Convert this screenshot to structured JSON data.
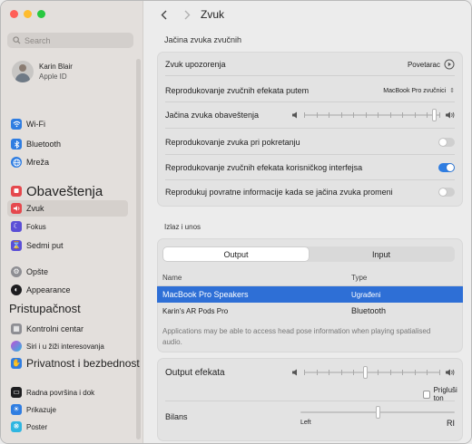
{
  "sidebar": {
    "search_placeholder": "Search",
    "account": {
      "name": "Karin Blair",
      "subtitle": "Apple ID"
    },
    "items": [
      {
        "label": "Wi-Fi",
        "icon": "wifi-icon",
        "color": "#2f7de1"
      },
      {
        "label": "Bluetooth",
        "icon": "bluetooth-icon",
        "color": "#2f7de1"
      },
      {
        "label": "Mreža",
        "icon": "globe-icon",
        "color": "#2f7de1"
      },
      {
        "label": "Obaveštenja",
        "icon": "bell-icon",
        "color": "#e5484d"
      },
      {
        "label": "Zvuk",
        "icon": "speaker-icon",
        "color": "#e5484d"
      },
      {
        "label": "Fokus",
        "icon": "moon-icon",
        "color": "#5b4fd6"
      },
      {
        "label": "Sedmi put",
        "icon": "hourglass-icon",
        "color": "#5b4fd6"
      },
      {
        "label": "Opšte",
        "icon": "gear-icon",
        "color": "#8e8e93"
      },
      {
        "label": "Appearance",
        "icon": "appearance-icon",
        "color": "#1d1d1f"
      },
      {
        "label": "Pristupačnost",
        "icon": "",
        "color": ""
      },
      {
        "label": "Kontrolni centar",
        "icon": "control-center-icon",
        "color": "#8e8e93"
      },
      {
        "label": "Siri i u žiži interesovanja",
        "icon": "siri-icon",
        "color": "#c04fd6"
      },
      {
        "label": "Privatnost i bezbednost",
        "icon": "hand-icon",
        "color": "#2f7de1"
      },
      {
        "label": "Radna površina i dok",
        "icon": "desktop-icon",
        "color": "#1d1d1f"
      },
      {
        "label": "Prikazuje",
        "icon": "display-icon",
        "color": "#2f7de1"
      },
      {
        "label": "Poster",
        "icon": "wallpaper-icon",
        "color": "#2fb6e1"
      }
    ]
  },
  "header": {
    "title": "Zvuk"
  },
  "effects": {
    "section": "Jačina zvuka zvučnih",
    "alert_sound_label": "Zvuk upozorenja",
    "alert_sound_value": "Povetarac",
    "play_through_label": "Reprodukovanje zvučnih efekata putem",
    "play_through_value": "MacBook Pro zvučnici",
    "alert_volume_label": "Jačina zvuka obaveštenja",
    "alert_volume_level": 0.97,
    "startup_label": "Reprodukovanje zvuka pri pokretanju",
    "startup_on": false,
    "ui_effects_label": "Reprodukovanje zvučnih efekata korisničkog interfejsa",
    "ui_effects_on": true,
    "feedback_label": "Reprodukuj povratne informacije kada se jačina zvuka promeni",
    "feedback_on": false
  },
  "io": {
    "section": "Izlaz i unos",
    "tabs": [
      "Output",
      "Input"
    ],
    "selected_tab": "Output",
    "columns": [
      "Name",
      "Type"
    ],
    "devices": [
      {
        "name": "MacBook Pro Speakers",
        "type": "Ugrađeni",
        "selected": true
      },
      {
        "name": "Karin's AR Pods Pro",
        "type": "Bluetooth",
        "selected": false
      }
    ],
    "note": "Applications may be able to access head pose information when playing spatialised audio."
  },
  "output": {
    "volume_label": "Output efekata",
    "volume_level": 0.45,
    "mute_label": "Prigluši ton",
    "balance_label": "Bilans",
    "balance_left": "Left",
    "balance_right": "RI",
    "balance_level": 0.5
  }
}
